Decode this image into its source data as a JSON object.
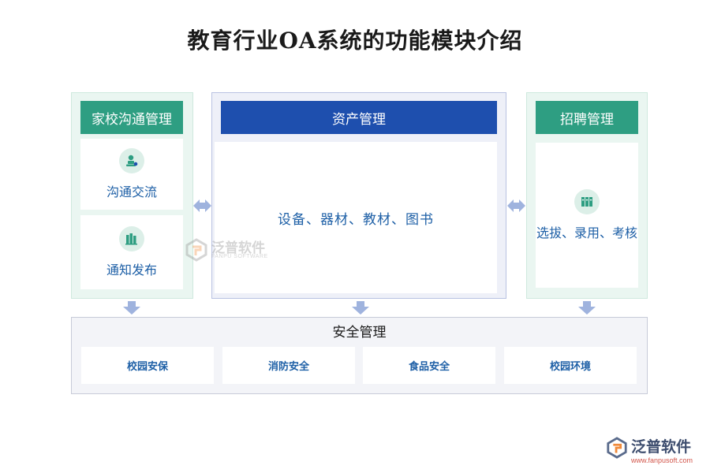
{
  "title": "教育行业OA系统的功能模块介绍",
  "colors": {
    "green_header": "#2e9e82",
    "blue_header": "#1e4fae",
    "label_blue": "#1d5fa6",
    "arrow": "#9fb3de"
  },
  "left_module": {
    "header": "家校沟通管理",
    "items": [
      {
        "label": "沟通交流",
        "icon": "stamp-person-icon"
      },
      {
        "label": "通知发布",
        "icon": "books-icon"
      }
    ]
  },
  "middle_module": {
    "header": "资产管理",
    "content": "设备、器材、教材、图书"
  },
  "right_module": {
    "header": "招聘管理",
    "items": [
      {
        "label": "选拔、录用、考核",
        "icon": "binders-icon"
      }
    ]
  },
  "bottom_module": {
    "header": "安全管理",
    "items": [
      "校园安保",
      "消防安全",
      "食品安全",
      "校园环境"
    ]
  },
  "watermark": {
    "name": "泛普软件",
    "sub": "FANPU SOFTWARE",
    "url": "www.fanpusoft.com"
  }
}
